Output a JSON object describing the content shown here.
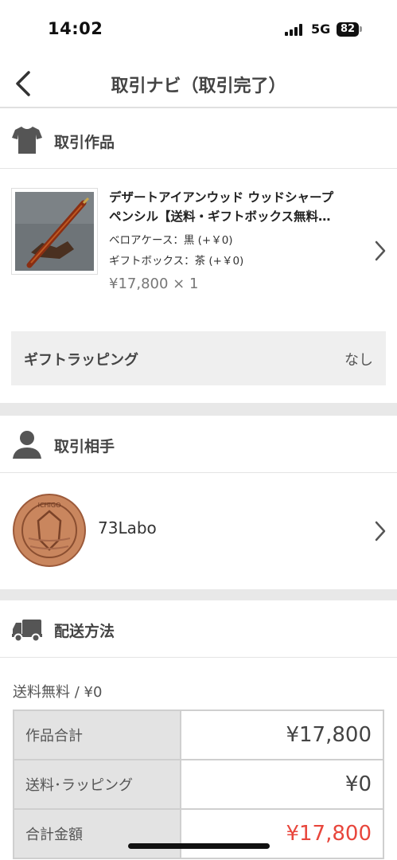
{
  "status_bar": {
    "time": "14:02",
    "network": "5G",
    "battery": "82"
  },
  "nav": {
    "title": "取引ナビ（取引完了）"
  },
  "sections": {
    "product": "取引作品",
    "partner": "取引相手",
    "shipping": "配送方法"
  },
  "product": {
    "name_line1": "デザートアイアンウッド ウッドシャープ",
    "name_line2": "ペンシル【送料・ギフトボックス無料…",
    "option1": "ベロアケース：黒 (+￥0)",
    "option2": "ギフトボックス：茶 (+￥0)",
    "price": "¥17,800 × 1"
  },
  "gift_wrapping": {
    "label": "ギフトラッピング",
    "value": "なし"
  },
  "partner": {
    "name": "73Labo",
    "avatar_text": "ICHIGO"
  },
  "shipping": {
    "method": "送料無料 / ¥0",
    "rows": [
      {
        "label": "作品合計",
        "value": "¥17,800"
      },
      {
        "label": "送料･ラッピング",
        "value": "¥0"
      },
      {
        "label": "合計金額",
        "value": "¥17,800"
      }
    ]
  },
  "colors": {
    "accent_red": "#e8463c",
    "band_gray": "#e8e8e8"
  },
  "icons": [
    "back-icon",
    "tshirt-icon",
    "person-icon",
    "truck-icon",
    "chevron-right-icon"
  ]
}
